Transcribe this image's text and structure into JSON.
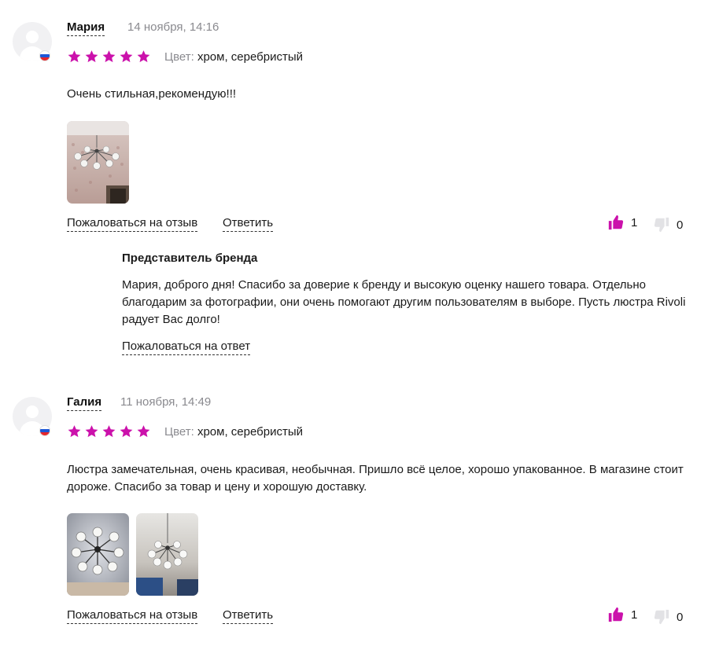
{
  "accent_color": "#cb11ab",
  "reviews": [
    {
      "author": "Мария",
      "date": "14 ноября, 14:16",
      "rating": 5,
      "color_label": "Цвет:",
      "color_value": "хром, серебристый",
      "text": "Очень стильная,рекомендую!!!",
      "photos": [
        "chandelier-photo-1"
      ],
      "report_label": "Пожаловаться на отзыв",
      "reply_label": "Ответить",
      "likes": "1",
      "dislikes": "0",
      "brand_reply": {
        "title": "Представитель бренда",
        "text": "Мария, доброго дня! Спасибо за доверие к бренду и высокую оценку нашего товара. Отдельно благодарим за фотографии, они очень помогают другим пользователям в выборе. Пусть люстра Rivoli радует Вас долго!",
        "report_label": "Пожаловаться на ответ"
      }
    },
    {
      "author": "Галия",
      "date": "11 ноября, 14:49",
      "rating": 5,
      "color_label": "Цвет:",
      "color_value": "хром, серебристый",
      "text": "Люстра замечательная, очень красивая, необычная. Пришло всё целое, хорошо упакованное. В магазине стоит дороже. Спасибо за товар и цену и хорошую доставку.",
      "photos": [
        "chandelier-photo-2",
        "chandelier-photo-3"
      ],
      "report_label": "Пожаловаться на отзыв",
      "reply_label": "Ответить",
      "likes": "1",
      "dislikes": "0"
    }
  ]
}
